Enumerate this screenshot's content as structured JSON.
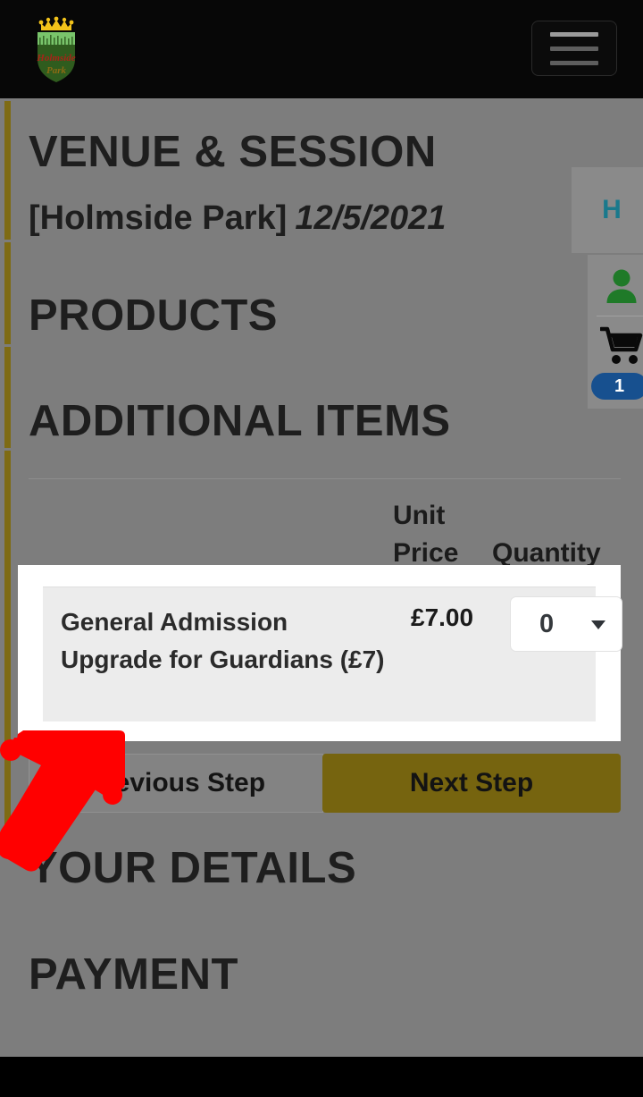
{
  "topbar": {
    "logo_name": "Holmside Park",
    "logo_line1": "Holmside",
    "logo_line2": "Park",
    "menu_label": "Menu"
  },
  "sections": {
    "venue_session": "VENUE & SESSION",
    "products": "PRODUCTS",
    "additional_items": "ADDITIONAL ITEMS",
    "your_details": "YOUR DETAILS",
    "payment": "PAYMENT"
  },
  "venue": {
    "name": "[Holmside Park]",
    "date": "12/5/2021"
  },
  "table": {
    "headers": {
      "unit_price": "Unit Price",
      "quantity": "Quantity"
    },
    "rows": [
      {
        "name": "General Admission Upgrade for Guardians (£7)",
        "unit_price": "£7.00",
        "quantity": "0"
      }
    ]
  },
  "buttons": {
    "previous": "Previous Step",
    "next": "Next Step"
  },
  "side_panel": {
    "language_letter": "H",
    "cart_count": "1"
  },
  "colors": {
    "background": "#7d7d7d",
    "topbar": "#070707",
    "accent_olive": "#76640f",
    "left_stripe": "#7e6b14",
    "badge_blue": "#17508f",
    "lang_teal": "#19798c",
    "user_green": "#1f7a28",
    "annotation_red": "#ff0000",
    "highlight_white": "#ffffff"
  }
}
